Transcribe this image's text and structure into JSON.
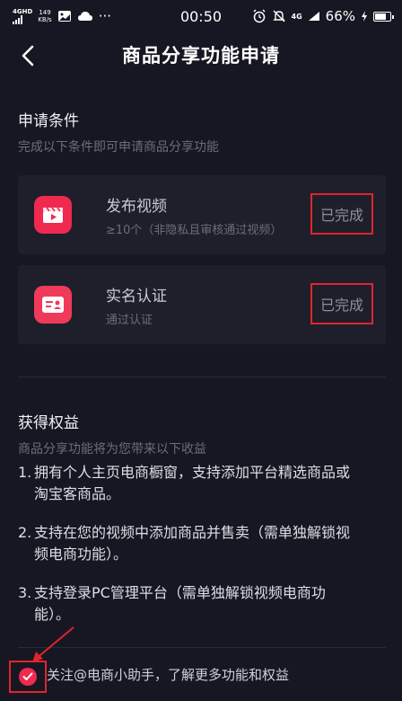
{
  "status_bar": {
    "network": "4G",
    "network_sup": "HD",
    "speed_value": "149",
    "speed_unit": "KB/s",
    "more": "···",
    "time": "00:50",
    "net2": "4G",
    "battery_pct": "66%"
  },
  "nav": {
    "title": "商品分享功能申请"
  },
  "conditions": {
    "title": "申请条件",
    "subtitle": "完成以下条件即可申请商品分享功能",
    "items": [
      {
        "title": "发布视频",
        "subtitle": "≥10个（非隐私且审核通过视频）",
        "status": "已完成",
        "icon": "video-clapper-icon"
      },
      {
        "title": "实名认证",
        "subtitle": "通过认证",
        "status": "已完成",
        "icon": "id-card-icon"
      }
    ]
  },
  "benefits": {
    "title": "获得权益",
    "subtitle": "商品分享功能将为您带来以下收益",
    "items": [
      {
        "num": "1.",
        "line1": "拥有个人主页电商橱窗，支持添加平台精选商品或",
        "line2": "淘宝客商品。"
      },
      {
        "num": "2.",
        "line1": "支持在您的视频中添加商品并售卖（需单独解锁视",
        "line2": "频电商功能）。"
      },
      {
        "num": "3.",
        "line1": "支持登录PC管理平台（需单独解锁视频电商功",
        "line2": "能）。"
      }
    ]
  },
  "follow": {
    "text": "关注@电商小助手，了解更多功能和权益",
    "checked": true
  },
  "colors": {
    "background": "#161722",
    "card": "#1e1f2b",
    "accent": "#f0294f",
    "highlight_box": "#e0242c"
  }
}
